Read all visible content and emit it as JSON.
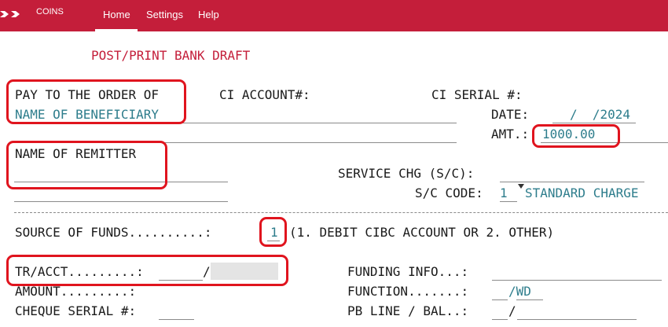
{
  "app": {
    "name": "COINS"
  },
  "nav": {
    "home": "Home",
    "settings": "Settings",
    "help": "Help"
  },
  "screen": {
    "title": "POST/PRINT BANK DRAFT"
  },
  "labels": {
    "pay_to": "PAY TO THE ORDER OF",
    "ci_account": "CI ACCOUNT#:",
    "ci_serial": "CI SERIAL #:",
    "date": "DATE:",
    "amt": "AMT.:",
    "name_of_remitter": "NAME OF REMITTER",
    "service_chg": "SERVICE CHG (S/C):",
    "sc_code": "S/C CODE:",
    "source_of_funds": "SOURCE OF FUNDS..........:",
    "source_options": "(1. DEBIT CIBC ACCOUNT OR 2. OTHER)",
    "tr_acct": "TR/ACCT.........:",
    "amount": "AMOUNT.........:",
    "cheque_serial": "CHEQUE SERIAL #:",
    "funding_info": "FUNDING INFO...:",
    "function": "FUNCTION.......:",
    "pb_line_bal": "PB LINE / BAL..:"
  },
  "fields": {
    "beneficiary": "NAME OF BENEFICIARY",
    "date_value": "/  /2024",
    "amt_value": "1000.00",
    "sc_code_value": "1",
    "sc_code_desc": "STANDARD CHARGE",
    "source_of_funds_value": "1",
    "tr_acct_sep": "/",
    "function_value": "/WD",
    "pb_line_sep": "/"
  },
  "colors": {
    "brand": "#c41e3a",
    "highlight": "#e0141e",
    "field_text": "#2e7d8c"
  }
}
